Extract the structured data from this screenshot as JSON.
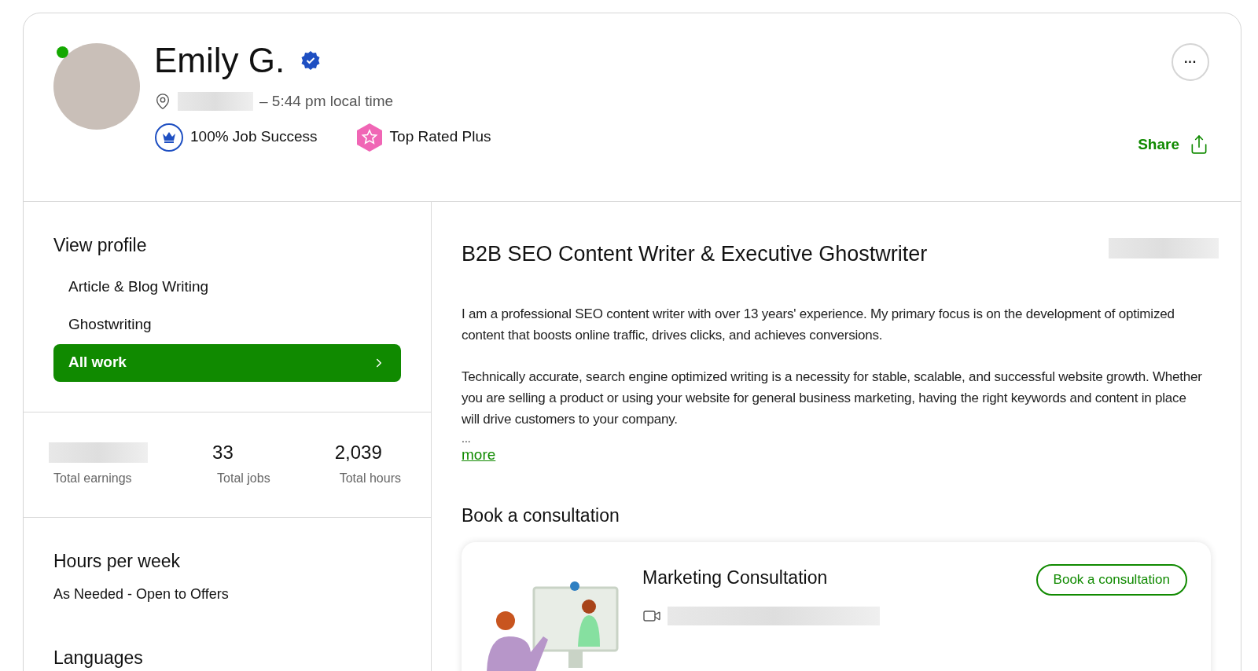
{
  "profile": {
    "name": "Emily G.",
    "online": true,
    "verified": true,
    "local_time": "– 5:44 pm local time",
    "badges": [
      {
        "kind": "job-success",
        "label": "100% Job Success"
      },
      {
        "kind": "top-rated",
        "label": "Top Rated Plus"
      }
    ],
    "share": "Share",
    "more": "···"
  },
  "sidebar": {
    "heading": "View profile",
    "items": [
      {
        "label": "Article & Blog Writing",
        "selected": false
      },
      {
        "label": "Ghostwriting",
        "selected": false
      },
      {
        "label": "All work",
        "selected": true
      }
    ]
  },
  "stats": [
    {
      "label": "Total earnings"
    },
    {
      "value": "33",
      "label": "Total jobs"
    },
    {
      "value": "2,039",
      "label": "Total hours"
    }
  ],
  "hours": {
    "heading": "Hours per week",
    "value": "As Needed - Open to Offers"
  },
  "languages": {
    "heading": "Languages"
  },
  "main": {
    "title": "B2B SEO Content Writer & Executive Ghostwriter",
    "paragraphs": [
      "I am a professional SEO content writer with over 13 years' experience. My primary focus is on the development of optimized content that boosts online traffic, drives clicks, and achieves conversions.",
      "Technically accurate, search engine optimized writing is a necessity for stable, scalable, and successful website growth. Whether you are selling a product or using your website for general business marketing, having the right keywords and content in place will drive customers to your company."
    ],
    "ellipsis": "...",
    "more": "more"
  },
  "consultation": {
    "heading": "Book a consultation",
    "card_title": "Marketing Consultation",
    "button": "Book a consultation"
  }
}
